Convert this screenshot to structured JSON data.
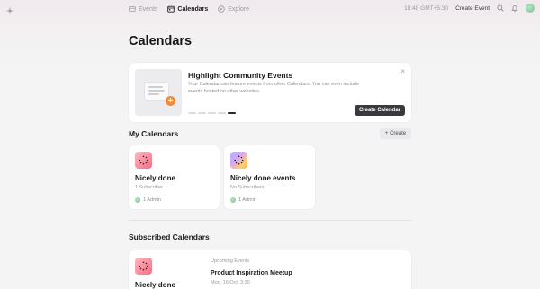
{
  "nav": {
    "items": [
      {
        "label": "Events",
        "icon": "ticket-icon"
      },
      {
        "label": "Calendars",
        "icon": "calendar-icon",
        "active": true
      },
      {
        "label": "Explore",
        "icon": "compass-icon"
      }
    ]
  },
  "topbar": {
    "clock": "18:48 GMT+5:30",
    "create_event": "Create Event"
  },
  "page": {
    "title": "Calendars"
  },
  "highlight": {
    "title": "Highlight Community Events",
    "description": "Your Calendar can feature events from other Calendars. You can even include events hosted on other websites.",
    "button": "Create Calendar",
    "close": "×",
    "step_count": 5,
    "active_step": 5
  },
  "my_calendars": {
    "title": "My Calendars",
    "create_label": "+ Create",
    "items": [
      {
        "name": "Nicely done",
        "subscribers": "1 Subscriber",
        "admins": "1 Admin"
      },
      {
        "name": "Nicely done events",
        "subscribers": "No Subscribers",
        "admins": "1 Admin"
      }
    ]
  },
  "subscribed": {
    "title": "Subscribed Calendars",
    "items": [
      {
        "name": "Nicely done",
        "upcoming_label": "Upcoming Events",
        "event_title": "Product Inspiration Meetup",
        "event_time": "Mon, 16 Oct, 3:30"
      }
    ]
  },
  "colors": {
    "accent_dark": "#3a3a3e",
    "plus_orange": "#f08a3c",
    "pink_icon": "#f26f84"
  }
}
